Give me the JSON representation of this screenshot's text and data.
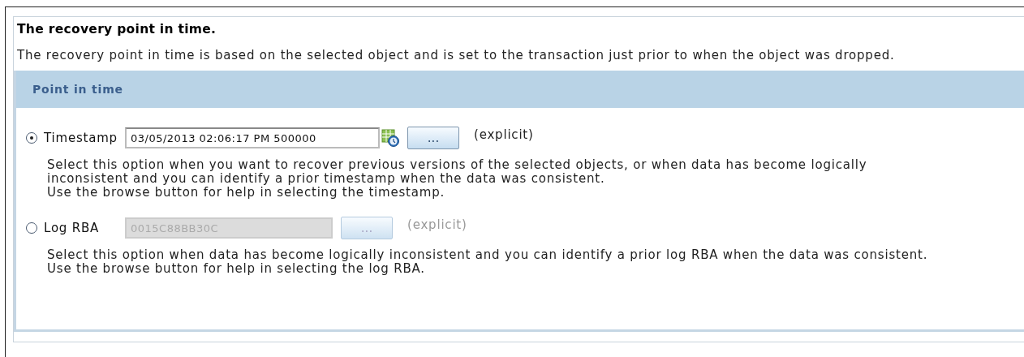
{
  "heading": "The recovery point in time.",
  "intro": "The recovery point in time is based on the selected object and is set to the transaction just prior to when the object was dropped.",
  "section": {
    "title": "Point in time"
  },
  "options": [
    {
      "label": "Timestamp",
      "selected": true,
      "disabled": false,
      "value": "03/05/2013 02:06:17 PM 500000",
      "picker_icon": true,
      "button": "...",
      "note": "(explicit)",
      "help": [
        "Select this option when you want to recover previous versions of the selected objects, or when data has become logically",
        "inconsistent and you can identify a prior timestamp when the data was consistent.",
        "Use the browse button for help in selecting the timestamp."
      ]
    },
    {
      "label": "Log RBA",
      "selected": false,
      "disabled": true,
      "value": "0015C88BB30C",
      "picker_icon": false,
      "button": "...",
      "note": "(explicit)",
      "help": [
        "Select this option when data has become logically inconsistent and you can identify a prior log RBA when the data was consistent.",
        "Use the browse button for help in selecting the log RBA."
      ]
    }
  ]
}
